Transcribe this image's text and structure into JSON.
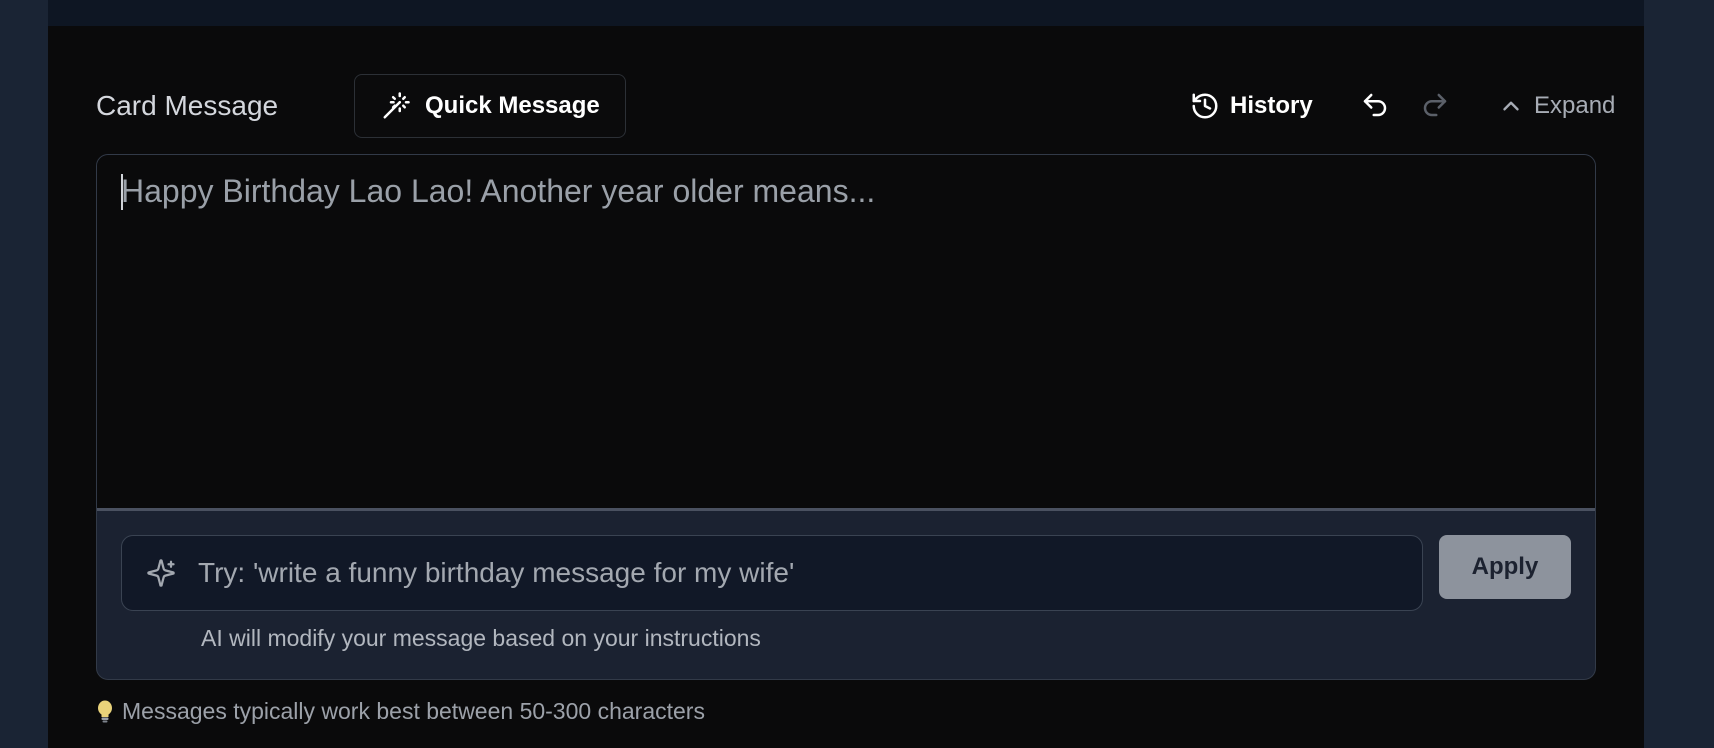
{
  "header": {
    "title": "Card Message",
    "quick_message_label": "Quick Message",
    "history_label": "History",
    "expand_label": "Expand"
  },
  "editor": {
    "message_text": "Happy Birthday Lao Lao! Another year older means..."
  },
  "ai_assist": {
    "placeholder": "Try: 'write a funny birthday message for my wife'",
    "apply_label": "Apply",
    "helper_text": "AI will modify your message based on your instructions"
  },
  "tip": {
    "text": "Messages typically work best between 50-300 characters",
    "icon": "lightbulb-icon"
  },
  "icons": {
    "quick_message": "magic-wand-icon",
    "history": "history-icon",
    "undo": "undo-icon",
    "redo": "redo-icon",
    "expand": "chevron-up-icon",
    "ai": "sparkles-icon"
  },
  "colors": {
    "panel_bg": "#0a0a0b",
    "page_bg": "#1a2434",
    "apply_bg": "#8d939d"
  }
}
